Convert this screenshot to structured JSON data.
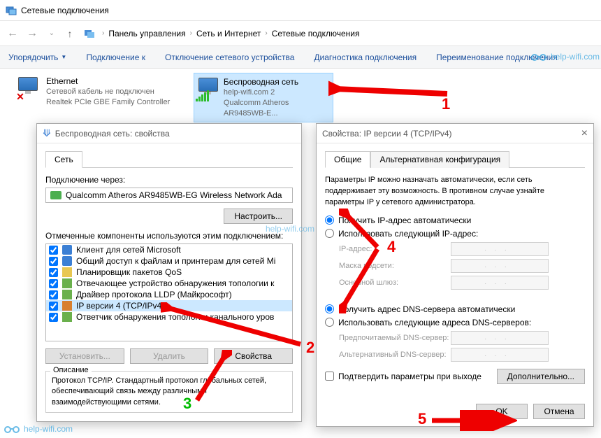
{
  "window": {
    "title": "Сетевые подключения"
  },
  "breadcrumb": [
    "Панель управления",
    "Сеть и Интернет",
    "Сетевые подключения"
  ],
  "toolbar": {
    "organize": "Упорядочить",
    "connect": "Подключение к",
    "disable": "Отключение сетевого устройства",
    "diag": "Диагностика подключения",
    "rename": "Переименование подключения"
  },
  "connections": [
    {
      "name": "Ethernet",
      "status": "Сетевой кабель не подключен",
      "device": "Realtek PCIe GBE Family Controller"
    },
    {
      "name": "Беспроводная сеть",
      "status": "help-wifi.com  2",
      "device": "Qualcomm Atheros AR9485WB-E..."
    }
  ],
  "props1": {
    "title": "Беспроводная сеть: свойства",
    "tab_net": "Сеть",
    "conn_via": "Подключение через:",
    "adapter": "Qualcomm Atheros AR9485WB-EG Wireless Network Ada",
    "configure": "Настроить...",
    "components_label": "Отмеченные компоненты используются этим подключением:",
    "components": [
      "Клиент для сетей Microsoft",
      "Общий доступ к файлам и принтерам для сетей Mi",
      "Планировщик пакетов QoS",
      "Отвечающее устройство обнаружения топологии к",
      "Драйвер протокола LLDP (Майкрософт)",
      "IP версии 4 (TCP/IPv4)",
      "Ответчик обнаружения топологии канального уров"
    ],
    "btn_install": "Установить...",
    "btn_remove": "Удалить",
    "btn_props": "Свойства",
    "desc_title": "Описание",
    "desc": "Протокол TCP/IP. Стандартный протокол глобальных сетей, обеспечивающий связь между различными взаимодействующими сетями."
  },
  "props2": {
    "title": "Свойства: IP версии 4 (TCP/IPv4)",
    "tab_general": "Общие",
    "tab_alt": "Альтернативная конфигурация",
    "para": "Параметры IP можно назначать автоматически, если сеть поддерживает эту возможность. В противном случае узнайте параметры IP у сетевого администратора.",
    "r_ip_auto": "Получить IP-адрес автоматически",
    "r_ip_manual": "Использовать следующий IP-адрес:",
    "ip_addr": "IP-адрес:",
    "mask": "Маска подсети:",
    "gw": "Основной шлюз:",
    "r_dns_auto": "Получить адрес DNS-сервера автоматически",
    "r_dns_manual": "Использовать следующие адреса DNS-серверов:",
    "dns_pref": "Предпочитаемый DNS-сервер:",
    "dns_alt": "Альтернативный DNS-сервер:",
    "confirm": "Подтвердить параметры при выходе",
    "advanced": "Дополнительно...",
    "ok": "OK",
    "cancel": "Отмена"
  },
  "watermark": "help-wifi.com",
  "annot": {
    "a1": "1",
    "a2": "2",
    "a3": "3",
    "a4": "4",
    "a5": "5"
  }
}
